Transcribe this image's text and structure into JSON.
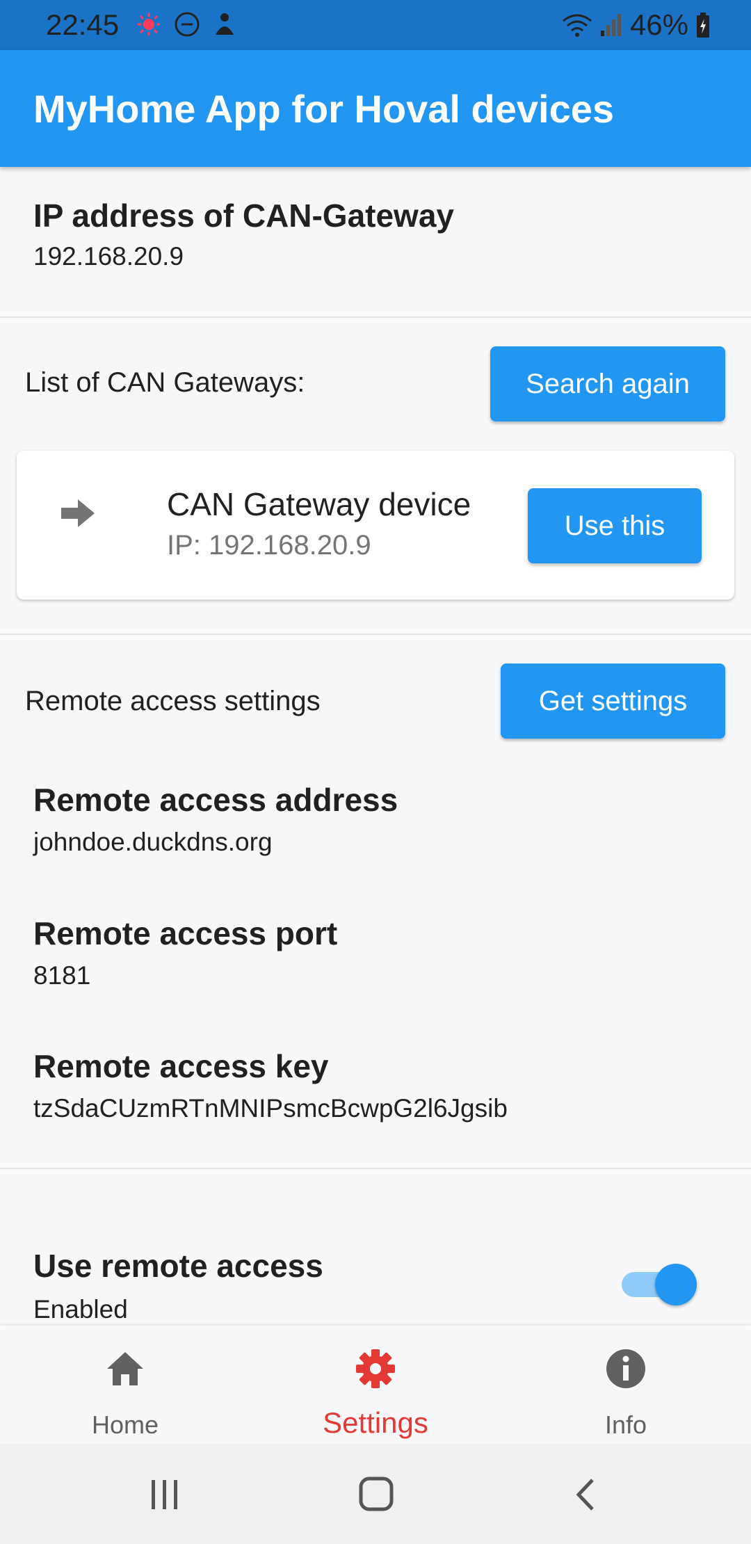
{
  "status_bar": {
    "time": "22:45",
    "battery": "46%",
    "icons": [
      "notification-icon",
      "dnd-icon",
      "app-icon",
      "wifi-icon",
      "signal-icon",
      "battery-icon"
    ]
  },
  "app_bar": {
    "title": "MyHome App for Hoval devices"
  },
  "gateway_ip": {
    "title": "IP address of CAN-Gateway",
    "value": "192.168.20.9"
  },
  "gateways": {
    "label": "List of CAN Gateways:",
    "search_button": "Search again",
    "items": [
      {
        "name": "CAN Gateway device",
        "ip": "IP: 192.168.20.9",
        "button": "Use this",
        "icon": "arrow-right-icon"
      }
    ]
  },
  "remote": {
    "label": "Remote access settings",
    "get_button": "Get settings",
    "address_title": "Remote access address",
    "address_value": "johndoe.duckdns.org",
    "port_title": "Remote access port",
    "port_value": "8181",
    "key_title": "Remote access key",
    "key_value": "tzSdaCUzmRTnMNIPsmcBcwpG2l6Jgsib",
    "use_title": "Use remote access",
    "use_value": "Enabled",
    "use_enabled": true
  },
  "bottom_nav": {
    "items": [
      {
        "label": "Home",
        "icon": "home-icon",
        "active": false
      },
      {
        "label": "Settings",
        "icon": "gear-icon",
        "active": true
      },
      {
        "label": "Info",
        "icon": "info-icon",
        "active": false
      }
    ]
  },
  "colors": {
    "primary": "#2196f3",
    "status_bar": "#1a73c6",
    "active_nav": "#e53935",
    "inactive_nav": "#616161"
  }
}
